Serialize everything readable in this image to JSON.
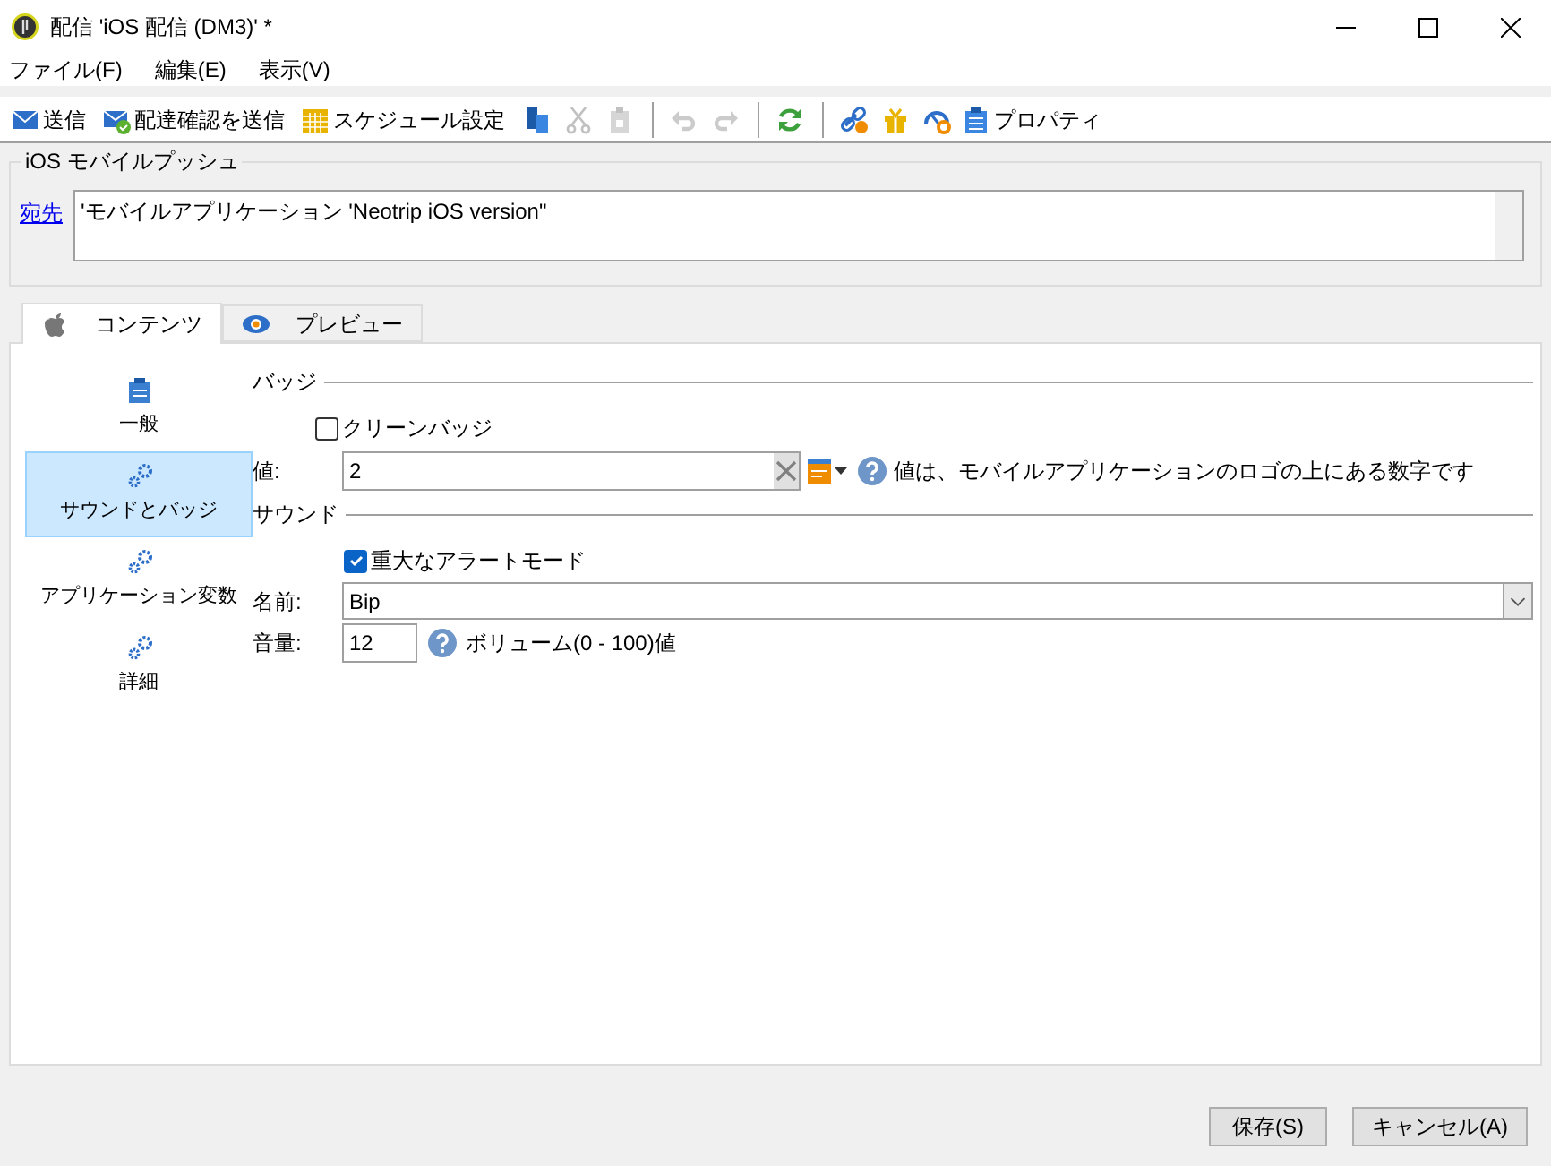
{
  "window": {
    "title": "配信 'iOS 配信 (DM3)' *"
  },
  "menu": [
    "ファイル(F)",
    "編集(E)",
    "表示(V)"
  ],
  "toolbar": [
    {
      "kind": "button",
      "label": "送信",
      "disabled": false
    },
    {
      "kind": "button",
      "label": "配達確認を送信",
      "disabled": false
    },
    {
      "kind": "button",
      "label": "スケジュール設定",
      "disabled": false
    },
    {
      "kind": "button",
      "disabled": false
    },
    {
      "kind": "button",
      "disabled": true
    },
    {
      "kind": "button",
      "disabled": true
    },
    {
      "kind": "separator"
    },
    {
      "kind": "button",
      "disabled": true
    },
    {
      "kind": "button",
      "disabled": true
    },
    {
      "kind": "separator"
    },
    {
      "kind": "button",
      "disabled": false
    },
    {
      "kind": "separator"
    },
    {
      "kind": "button",
      "disabled": false
    },
    {
      "kind": "button",
      "disabled": false
    },
    {
      "kind": "button",
      "disabled": false
    },
    {
      "kind": "button",
      "label": "プロパティ",
      "disabled": false
    }
  ],
  "push_group": {
    "title": "iOS モバイルプッシュ",
    "to_link": "宛先",
    "to_value": "'モバイルアプリケーション 'Neotrip iOS version\""
  },
  "tabs": [
    {
      "label": "コンテンツ",
      "selected": true
    },
    {
      "label": "プレビュー",
      "selected": false
    }
  ],
  "nav": [
    {
      "label": "一般",
      "selected": false
    },
    {
      "label": "サウンドとバッジ",
      "selected": true
    },
    {
      "label": "アプリケーション変数",
      "selected": false
    },
    {
      "label": "詳細",
      "selected": false
    }
  ],
  "badge_section": {
    "title": "バッジ",
    "clean_badge": {
      "label": "クリーンバッジ",
      "checked": false
    },
    "value_label": "値:",
    "value": "2",
    "help": "値は、モバイルアプリケーションのロゴの上にある数字です"
  },
  "sound_section": {
    "title": "サウンド",
    "critical": {
      "label": "重大なアラートモード",
      "checked": true
    },
    "name_label": "名前:",
    "name_value": "Bip",
    "volume_label": "音量:",
    "volume_value": "12",
    "volume_help": "ボリューム(0 - 100)値"
  },
  "buttons": [
    "保存(S)",
    "キャンセル(A)"
  ]
}
